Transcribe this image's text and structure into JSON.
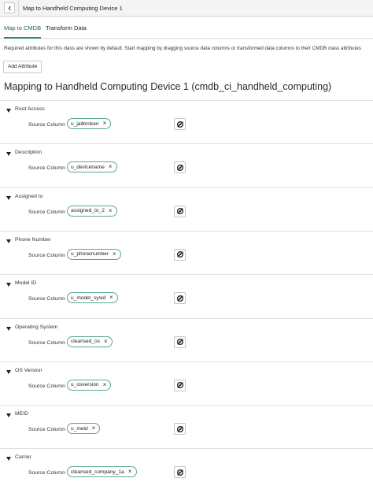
{
  "header": {
    "title": "Map to Handheld Computing Device 1"
  },
  "tabs": [
    {
      "label": "Map to CMDB",
      "active": true
    },
    {
      "label": "Transform Data",
      "active": false
    }
  ],
  "info_text": "Required attributes for this class are shown by default. Start mapping by dragging source data columns or transformed data columns to their CMDB class attributes",
  "add_attribute_label": "Add Attribute",
  "mapping_title": "Mapping to Handheld Computing Device 1 (cmdb_ci_handheld_computing)",
  "source_column_label": "Source Column",
  "colors": {
    "accent": "#2d8a73",
    "chip_border": "#5aa896"
  },
  "sections": [
    {
      "label": "Root Access",
      "column": "u_jailbroken"
    },
    {
      "label": "Description",
      "column": "u_devicename"
    },
    {
      "label": "Assigned to",
      "column": "assigned_to_2"
    },
    {
      "label": "Phone Number",
      "column": "u_phonenumber"
    },
    {
      "label": "Model ID",
      "column": "u_model_sysid"
    },
    {
      "label": "Operating System",
      "column": "cleansed_os"
    },
    {
      "label": "OS Version",
      "column": "u_osversion"
    },
    {
      "label": "MEID",
      "column": "u_meid"
    },
    {
      "label": "Carrier",
      "column": "cleansed_company_1a"
    }
  ]
}
